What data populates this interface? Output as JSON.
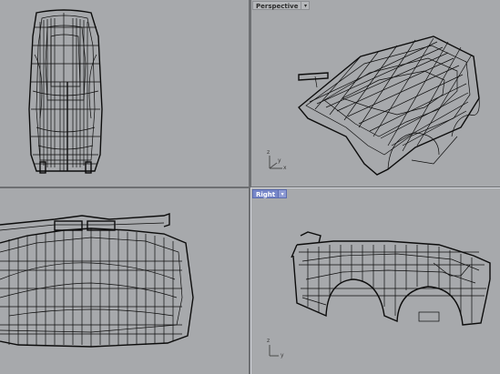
{
  "viewports": {
    "top": {
      "title": ""
    },
    "perspective": {
      "title": "Perspective",
      "menu_glyph": "▾"
    },
    "front": {
      "title": ""
    },
    "right": {
      "title": "Right",
      "menu_glyph": "▾"
    }
  },
  "axes": {
    "perspective": {
      "x": "x",
      "y": "y",
      "z": "z"
    },
    "right": {
      "y": "y",
      "z": "z"
    }
  },
  "colors": {
    "viewport_bg": "#a7a9ac",
    "divider": "#6d6f72",
    "wire": "#0c0c0c",
    "active_label_bg": "#7787c9"
  }
}
